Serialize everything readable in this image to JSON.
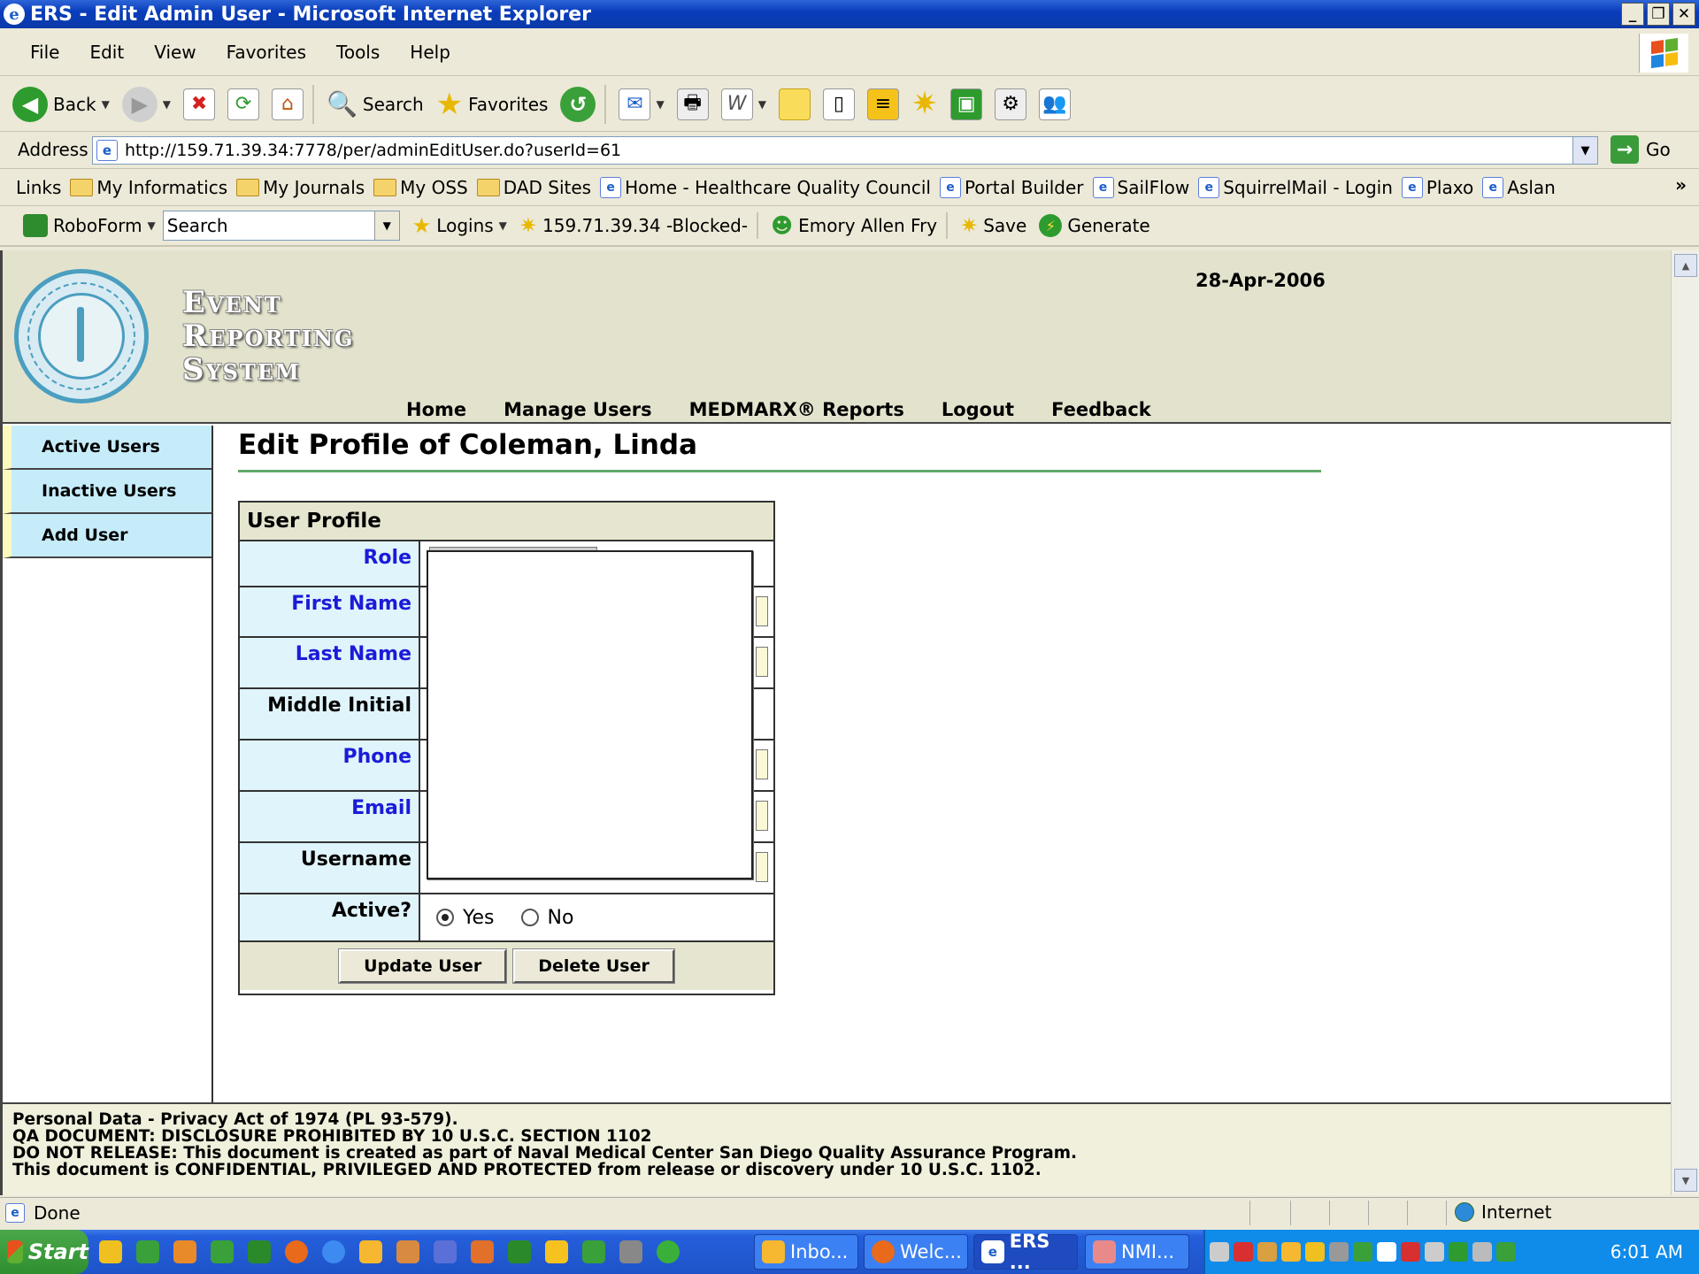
{
  "window": {
    "title": "ERS - Edit Admin User - Microsoft Internet Explorer"
  },
  "menu": [
    "File",
    "Edit",
    "View",
    "Favorites",
    "Tools",
    "Help"
  ],
  "toolbar": {
    "back": "Back",
    "search": "Search",
    "favorites": "Favorites"
  },
  "address": {
    "label": "Address",
    "url": "http://159.71.39.34:7778/per/adminEditUser.do?userId=61",
    "go": "Go"
  },
  "links": {
    "label": "Links",
    "items": [
      {
        "label": "My Informatics",
        "icon": "folder-icon"
      },
      {
        "label": "My Journals",
        "icon": "folder-icon"
      },
      {
        "label": "My OSS",
        "icon": "folder-icon"
      },
      {
        "label": "DAD Sites",
        "icon": "folder-icon"
      },
      {
        "label": "Home - Healthcare Quality Council",
        "icon": "page-icon"
      },
      {
        "label": "Portal Builder",
        "icon": "page-icon"
      },
      {
        "label": "SailFlow",
        "icon": "page-icon"
      },
      {
        "label": "SquirrelMail - Login",
        "icon": "page-icon"
      },
      {
        "label": "Plaxo",
        "icon": "page-icon"
      },
      {
        "label": "Aslan",
        "icon": "page-icon"
      }
    ],
    "more": "»"
  },
  "roboform": {
    "label": "RoboForm",
    "search": "Search",
    "logins": "Logins",
    "blocked": "159.71.39.34 -Blocked-",
    "user": "Emory Allen Fry",
    "save": "Save",
    "generate": "Generate"
  },
  "site": {
    "title_lines": [
      "Event",
      "Reporting",
      "System"
    ],
    "date": "28-Apr-2006",
    "nav": [
      "Home",
      "Manage Users",
      "MEDMARX® Reports",
      "Logout",
      "Feedback"
    ]
  },
  "sidebar": {
    "items": [
      "Active Users",
      "Inactive Users",
      "Add User"
    ]
  },
  "main": {
    "title": "Edit Profile of Coleman, Linda",
    "table_header": "User Profile",
    "fields": [
      {
        "label": "Role",
        "required": true
      },
      {
        "label": "First Name",
        "required": true
      },
      {
        "label": "Last Name",
        "required": true
      },
      {
        "label": "Middle Initial",
        "required": false
      },
      {
        "label": "Phone",
        "required": true
      },
      {
        "label": "Email",
        "required": true
      },
      {
        "label": "Username",
        "required": false
      }
    ],
    "active_label": "Active?",
    "active_options": [
      "Yes",
      "No"
    ],
    "active_value": "Yes",
    "buttons": {
      "update": "Update User",
      "delete": "Delete User"
    }
  },
  "footer": {
    "lines": [
      "Personal Data - Privacy Act of 1974 (PL 93-579).",
      "QA DOCUMENT: DISCLOSURE PROHIBITED BY 10 U.S.C. SECTION 1102",
      "DO NOT RELEASE: This document is created as part of Naval Medical Center San Diego Quality Assurance Program.",
      "This document is CONFIDENTIAL, PRIVILEGED AND PROTECTED from release or discovery under 10 U.S.C. 1102."
    ]
  },
  "status": {
    "text": "Done",
    "zone": "Internet"
  },
  "taskbar": {
    "start": "Start",
    "tasks": [
      "Inbo...",
      "Welc...",
      "ERS ...",
      "NMI..."
    ],
    "active_task": "ERS ...",
    "clock": "6:01 AM"
  },
  "colors": {
    "required_label": "#1b1bd8",
    "header_bg": "#e3e3cd",
    "sidebar_bg": "#c6ecfa",
    "rule": "#62a96a"
  }
}
